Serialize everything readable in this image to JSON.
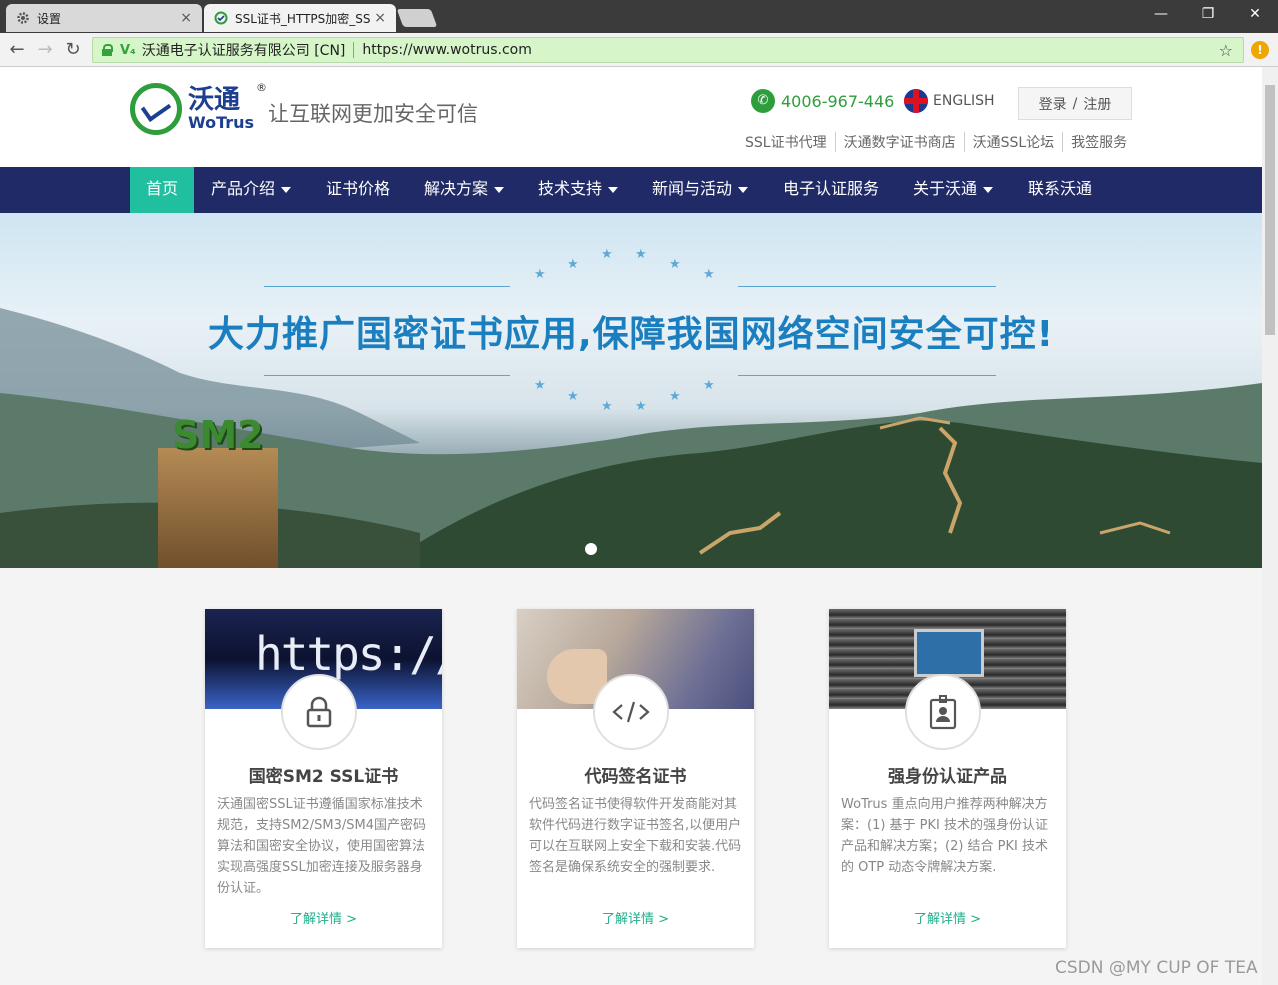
{
  "browser": {
    "tabs": [
      {
        "title": "设置",
        "close": "×"
      },
      {
        "title": "SSL证书_HTTPS加密_SS",
        "close": "×"
      }
    ],
    "window_controls": {
      "minimize": "—",
      "restore": "❐",
      "close": "✕"
    },
    "back": "←",
    "forward": "→",
    "reload": "↻",
    "address": {
      "ev_label": "V₄",
      "org": "沃通电子认证服务有限公司 [CN]",
      "url": "https://www.wotrus.com"
    },
    "bookmark": "☆",
    "alert": "!"
  },
  "site": {
    "logo": {
      "cn": "沃通",
      "en": "WoTrus",
      "reg": "®"
    },
    "slogan": "让互联网更加安全可信",
    "phone": "4006-967-446",
    "phone_icon": "✆",
    "english": "ENGLISH",
    "login": "登录",
    "slash": "/",
    "register": "注册",
    "top_links": [
      "SSL证书代理",
      "沃通数字证书商店",
      "沃通SSL论坛",
      "我签服务"
    ],
    "nav": [
      {
        "label": "首页",
        "dropdown": false
      },
      {
        "label": "产品介绍",
        "dropdown": true
      },
      {
        "label": "证书价格",
        "dropdown": false
      },
      {
        "label": "解决方案",
        "dropdown": true
      },
      {
        "label": "技术支持",
        "dropdown": true
      },
      {
        "label": "新闻与活动",
        "dropdown": true
      },
      {
        "label": "电子认证服务",
        "dropdown": false
      },
      {
        "label": "关于沃通",
        "dropdown": true
      },
      {
        "label": "联系沃通",
        "dropdown": false
      }
    ],
    "banner": {
      "title": "大力推广国密证书应用,保障我国网络空间安全可控!",
      "badge": "SM2"
    },
    "cards": [
      {
        "image_text": "https://",
        "icon": "lock-icon",
        "icon_glyph": "🔒",
        "title": "国密SM2 SSL证书",
        "desc": "沃通国密SSL证书遵循国家标准技术规范，支持SM2/SM3/SM4国产密码算法和国密安全协议，使用国密算法实现高强度SSL加密连接及服务器身份认证。",
        "link": "了解详情 >"
      },
      {
        "image_text": "",
        "icon": "code-icon",
        "icon_glyph": "</>",
        "title": "代码签名证书",
        "desc": "代码签名证书使得软件开发商能对其软件代码进行数字证书签名,以便用户可以在互联网上安全下载和安装.代码签名是确保系统安全的强制要求.",
        "link": "了解详情 >"
      },
      {
        "image_text": "",
        "icon": "id-badge-icon",
        "icon_glyph": "🪪",
        "title": "强身份认证产品",
        "desc": "WoTrus 重点向用户推荐两种解决方案：(1) 基于 PKI 技术的强身份认证产品和解决方案；(2) 结合 PKI 技术的 OTP 动态令牌解决方案.",
        "link": "了解详情 >"
      }
    ]
  },
  "watermark": "CSDN @MY CUP OF TEA",
  "colors": {
    "nav_bg": "#1f2a66",
    "nav_active": "#1fbf9f",
    "brand_green": "#2e9e3c",
    "brand_blue": "#1c3f8f",
    "banner_title": "#1b7fbf",
    "link": "#1fae8c"
  }
}
